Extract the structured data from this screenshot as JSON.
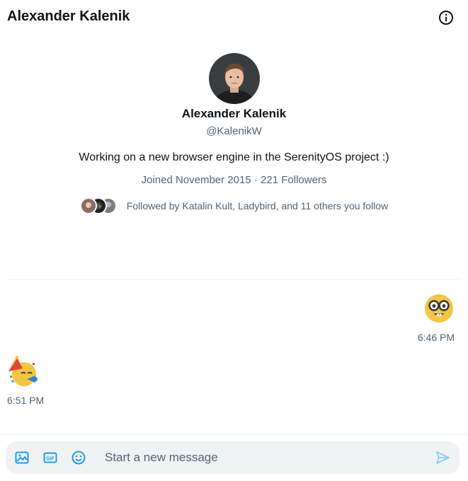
{
  "header": {
    "title": "Alexander Kalenik"
  },
  "profile": {
    "name": "Alexander Kalenik",
    "handle": "@KalenikW",
    "bio": "Working on a new browser engine in the SerenityOS project :)",
    "joined": "Joined November 2015",
    "followers": "221 Followers",
    "meta_separator": "·",
    "followed_by": "Followed by Katalin Kult, Ladybird, and 11 others you follow"
  },
  "messages": [
    {
      "side": "right",
      "emoji": "nerd-face",
      "time": "6:46 PM"
    },
    {
      "side": "left",
      "emoji": "partying-face",
      "time": "6:51 PM"
    }
  ],
  "composer": {
    "placeholder": "Start a new message",
    "value": ""
  },
  "colors": {
    "text": "#0f1419",
    "muted": "#536471",
    "accent": "#1d9bf0",
    "composer_bg": "#eff3f4"
  },
  "icons": {
    "info": "info-circle-icon",
    "media": "image-icon",
    "gif": "gif-icon",
    "emoji": "smiley-icon",
    "send": "send-icon"
  }
}
